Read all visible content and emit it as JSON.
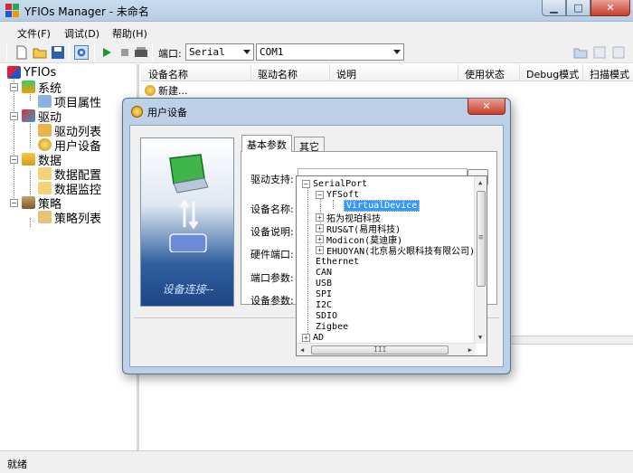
{
  "window": {
    "title": "YFIOs Manager - 未命名"
  },
  "menu": [
    "文件(F)",
    "调试(D)",
    "帮助(H)"
  ],
  "toolbar": {
    "port_label": "端口:",
    "port_value": "Serial",
    "com_value": "COM1"
  },
  "tree": {
    "root": "YFIOs",
    "groups": [
      {
        "label": "系统",
        "children": [
          "项目属性"
        ]
      },
      {
        "label": "驱动",
        "children": [
          "驱动列表",
          "用户设备"
        ]
      },
      {
        "label": "数据",
        "children": [
          "数据配置",
          "数据监控"
        ]
      },
      {
        "label": "策略",
        "children": [
          "策略列表"
        ]
      }
    ]
  },
  "list": {
    "columns": [
      "设备名称",
      "驱动名称",
      "说明",
      "使用状态",
      "Debug模式",
      "扫描模式"
    ],
    "rows": [
      "新建..."
    ]
  },
  "status": "就绪",
  "dialog": {
    "title": "用户设备",
    "illustration_caption": "设备连接--",
    "tabs": [
      "基本参数",
      "其它"
    ],
    "labels": [
      "驱动支持:",
      "设备名称:",
      "设备说明:",
      "硬件端口:",
      "端口参数:",
      "设备参数:"
    ],
    "browse_label": "..."
  },
  "driver_tree": {
    "serial_port": "SerialPort",
    "yfsoft": "YFSoft",
    "selected": "VirtualDevice",
    "serial_vendors": [
      "拓为视珀科技",
      "RUS&T(易用科技)",
      "Modicon(莫迪康)",
      "EHUOYAN(北京易火眼科技有限公司)"
    ],
    "others": [
      "Ethernet",
      "CAN",
      "USB",
      "SPI",
      "I2C",
      "SDIO",
      "Zigbee",
      "AD"
    ],
    "hscroll_grip": "III",
    "vscroll_grip": "≡"
  }
}
